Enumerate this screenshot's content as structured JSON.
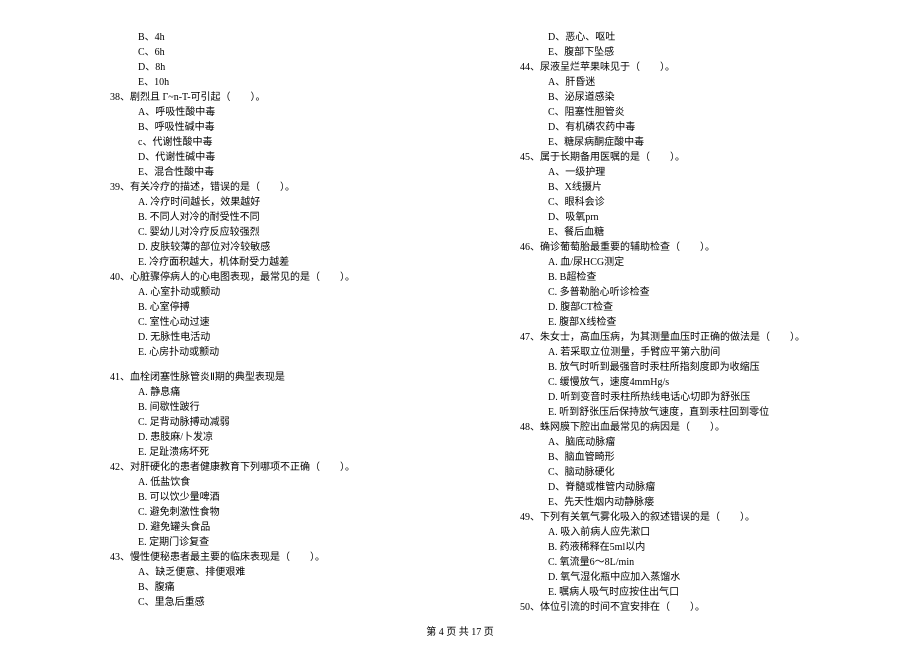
{
  "left": {
    "q37_opts": [
      "B、4h",
      "C、6h",
      "D、8h",
      "E、10h"
    ],
    "q38": "38、剧烈且 Γ~n-T-可引起（　　）。",
    "q38_opts": [
      "A、呼吸性酸中毒",
      "B、呼吸性碱中毒",
      "c、代谢性酸中毒",
      "D、代谢性碱中毒",
      "E、混合性酸中毒"
    ],
    "q39": "39、有关冷疗的描述，错误的是（　　）。",
    "q39_opts": [
      "A. 冷疗时间越长，效果越好",
      "B. 不同人对冷的耐受性不同",
      "C. 婴幼儿对冷疗反应较强烈",
      "D. 皮肤较薄的部位对冷较敏感",
      "E. 冷疗面积越大，机体耐受力越差"
    ],
    "q40": "40、心脏骤停病人的心电图表现，最常见的是（　　）。",
    "q40_opts": [
      "A. 心室扑动或颤动",
      "B. 心室停搏",
      "C. 室性心动过速",
      "D. 无脉性电活动",
      "E. 心房扑动或颤动"
    ],
    "q41": "41、血栓闭塞性脉管炎Ⅱ期的典型表现是",
    "q41_opts": [
      "A. 静息痛",
      "B. 间歇性跛行",
      "C. 足背动脉搏动减弱",
      "D. 患肢麻/卜发凉",
      "E. 足趾溃疡坏死"
    ],
    "q42": "42、对肝硬化的患者健康教育下列哪项不正确（　　）。",
    "q42_opts": [
      "A. 低盐饮食",
      "B. 可以饮少量啤酒",
      "C. 避免刺激性食物",
      "D. 避免罐头食品",
      "E. 定期门诊复查"
    ],
    "q43": "43、慢性便秘患者最主要的临床表现是（　　）。",
    "q43_opts": [
      "A、缺乏便意、排便艰难",
      "B、腹痛",
      "C、里急后重感"
    ]
  },
  "right": {
    "q43_opts_cont": [
      "D、恶心、呕吐",
      "E、腹部下坠感"
    ],
    "q44": "44、尿液呈烂苹果味见于（　　）。",
    "q44_opts": [
      "A、肝昏迷",
      "B、泌尿道感染",
      "C、阻塞性胆管炎",
      "D、有机磷农药中毒",
      "E、糖尿病酮症酸中毒"
    ],
    "q45": "45、属于长期备用医嘱的是（　　）。",
    "q45_opts": [
      "A、一级护理",
      "B、X线摄片",
      "C、眼科会诊",
      "D、吸氧prn",
      "E、餐后血糖"
    ],
    "q46": "46、确诊葡萄胎最重要的辅助检查（　　）。",
    "q46_opts": [
      "A. 血/尿HCG测定",
      "B. B超检查",
      "C. 多普勒胎心听诊检查",
      "D. 腹部CT检查",
      "E. 腹部X线检查"
    ],
    "q47": "47、朱女士，高血压病，为其测量血压时正确的做法是（　　）。",
    "q47_opts": [
      "A. 若采取立位测量，手臂应平第六肋间",
      "B. 放气时听到最强音时汞柱所指刻度即为收缩压",
      "C. 缓慢放气，速度4mmHg/s",
      "D. 听到变音时汞柱所热线电话心切即为舒张压",
      "E. 听到舒张压后保持放气速度，直到汞柱回到零位"
    ],
    "q48": "48、蛛网膜下腔出血最常见的病因是（　　）。",
    "q48_opts": [
      "A、脑底动脉瘤",
      "B、脑血管畸形",
      "C、脑动脉硬化",
      "D、脊髓或椎管内动脉瘤",
      "E、先天性烟内动静脉瘘"
    ],
    "q49": "49、下列有关氧气雾化吸入的叙述错误的是（　　）。",
    "q49_opts": [
      "A. 吸入前病人应先漱口",
      "B. 药液稀释在5ml以内",
      "C. 氧流量6～8L/min",
      "D. 氧气湿化瓶中应加入蒸馏水",
      "E. 嘱病人吸气时应按住出气口"
    ],
    "q50": "50、体位引流的时间不宜安排在（　　）。"
  },
  "footer": "第 4 页 共 17 页"
}
